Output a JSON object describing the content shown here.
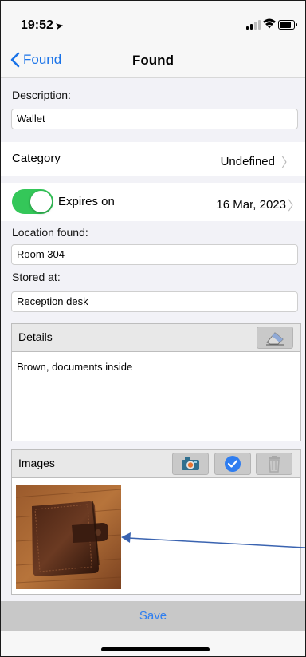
{
  "status": {
    "time": "19:52"
  },
  "nav": {
    "back_label": "Found",
    "title": "Found"
  },
  "form": {
    "description": {
      "label": "Description:",
      "value": "Wallet"
    },
    "category": {
      "label": "Category",
      "value": "Undefined"
    },
    "expires": {
      "label": "Expires on",
      "value": "16 Mar, 2023",
      "enabled": true
    },
    "location": {
      "label": "Location found:",
      "value": "Room 304"
    },
    "stored": {
      "label": "Stored at:",
      "value": "Reception desk"
    },
    "details": {
      "title": "Details",
      "text": "Brown, documents inside"
    },
    "images": {
      "title": "Images"
    }
  },
  "save_label": "Save",
  "colors": {
    "accent": "#1a73e8",
    "toggle_on": "#34c759",
    "arrow": "#3a63b0"
  },
  "icons": [
    "location-arrow-icon",
    "signal-icon",
    "wifi-icon",
    "battery-icon",
    "back-chevron-icon",
    "chevron-right-icon",
    "eraser-icon",
    "camera-icon",
    "checkmark-circle-icon",
    "trash-icon"
  ]
}
